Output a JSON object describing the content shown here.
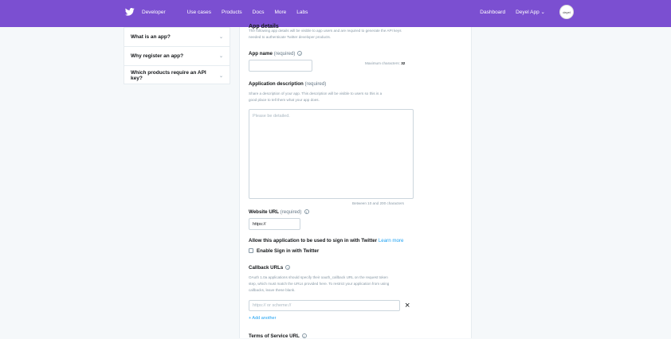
{
  "nav": {
    "brand": "Developer",
    "links": [
      "Use cases",
      "Products",
      "Docs",
      "More",
      "Labs"
    ],
    "dashboard": "Dashboard",
    "app_menu": "Deyel App",
    "avatar_text": "deyel"
  },
  "faq": [
    "What is an app?",
    "Why register an app?",
    "Which products require an API key?"
  ],
  "form": {
    "section_title": "App details",
    "intro": "The following app details will be visible to app users and are required to generate the API keys needed to authenticate Twitter developer products.",
    "app_name_label": "App name",
    "required": "(required)",
    "max_chars_label": "Maximum characters:",
    "max_chars_value": "32",
    "desc_label": "Application description",
    "desc_help_1": "Share a description of your app. This description will be visible to users so this is a",
    "desc_help_2": "good place to tell them what your app does.",
    "desc_placeholder": "Please be detailed.",
    "desc_counter": "Between 10 and 200 characters",
    "website_label": "Website URL",
    "website_value": "https://",
    "signin_label": "Allow this application to be used to sign in with Twitter",
    "learn_more": "Learn more",
    "enable_signin": "Enable Sign in with Twitter",
    "callback_label": "Callback URLs",
    "callback_help_1": "OAuth 1.0a applications should specify their oauth_callback URL on the request token",
    "callback_help_2": "step, which must match the URLs provided here. To restrict your application from using",
    "callback_help_3": "callbacks, leave these blank.",
    "callback_placeholder": "https:// or scheme://",
    "add_another": "+ Add another",
    "tos_label": "Terms of Service URL"
  }
}
